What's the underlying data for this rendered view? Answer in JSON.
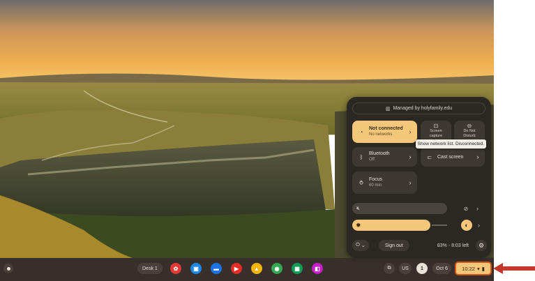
{
  "qs": {
    "managed_text": "Managed by holyfamily.edu",
    "network_title": "Not connected",
    "network_sub": "No networks",
    "screen_label_1": "Screen",
    "screen_label_2": "capture",
    "dnd_label_1": "Do Not",
    "dnd_label_2": "Disturb",
    "bluetooth_title": "Bluetooth",
    "bluetooth_sub": "Off",
    "cast_title": "Cast screen",
    "focus_title": "Focus",
    "focus_sub": "60 min",
    "tooltip": "Show network list. Disconnected.",
    "brightness_level": 0.82,
    "signout_label": "Sign out",
    "battery_text": "83% - 8:03 left"
  },
  "shelf": {
    "desk_label": "Desk 1",
    "apps": [
      {
        "name": "app-palette-icon",
        "glyph": "✿",
        "color": "#e53935"
      },
      {
        "name": "app-classroom-icon",
        "glyph": "▣",
        "color": "#1e88e5"
      },
      {
        "name": "app-files-icon",
        "glyph": "▬",
        "color": "#1a73e8"
      },
      {
        "name": "app-youtube-icon",
        "glyph": "▶",
        "color": "#e52d27"
      },
      {
        "name": "app-drive-icon",
        "glyph": "▲",
        "color": "#f4b400"
      },
      {
        "name": "app-chrome-icon",
        "glyph": "◉",
        "color": "#34a853"
      },
      {
        "name": "app-sheets-icon",
        "glyph": "▦",
        "color": "#0f9d58"
      },
      {
        "name": "app-purple-icon",
        "glyph": "◧",
        "color": "#c51ec9"
      }
    ],
    "keyboard_layout": "US",
    "notification_count": "1",
    "date": "Oct 6",
    "time": "10:22"
  },
  "colors": {
    "accent": "#f5c77a",
    "annotation": "#d4541a"
  }
}
